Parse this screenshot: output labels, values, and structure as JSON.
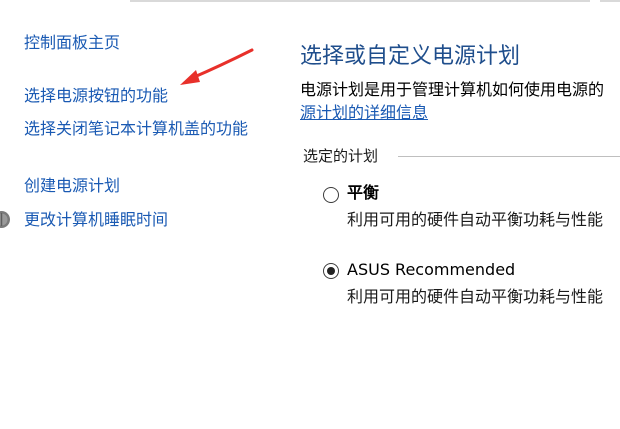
{
  "sidebar": {
    "home": "控制面板主页",
    "power_buttons": "选择电源按钮的功能",
    "lid_close": "选择关闭笔记本计算机盖的功能",
    "create_plan": "创建电源计划",
    "sleep_time": "更改计算机睡眠时间"
  },
  "main": {
    "title": "选择或自定义电源计划",
    "description": "电源计划是用于管理计算机如何使用电源的",
    "description_link": "源计划的详细信息",
    "selected_plans_label": "选定的计划",
    "plans": [
      {
        "name": "平衡",
        "description": "利用可用的硬件自动平衡功耗与性能",
        "selected": false
      },
      {
        "name": "ASUS Recommended",
        "description": "利用可用的硬件自动平衡功耗与性能",
        "selected": true
      }
    ]
  },
  "colors": {
    "link": "#1a5ab3",
    "title": "#1f4e8c",
    "annotation_arrow": "#e8302a"
  }
}
